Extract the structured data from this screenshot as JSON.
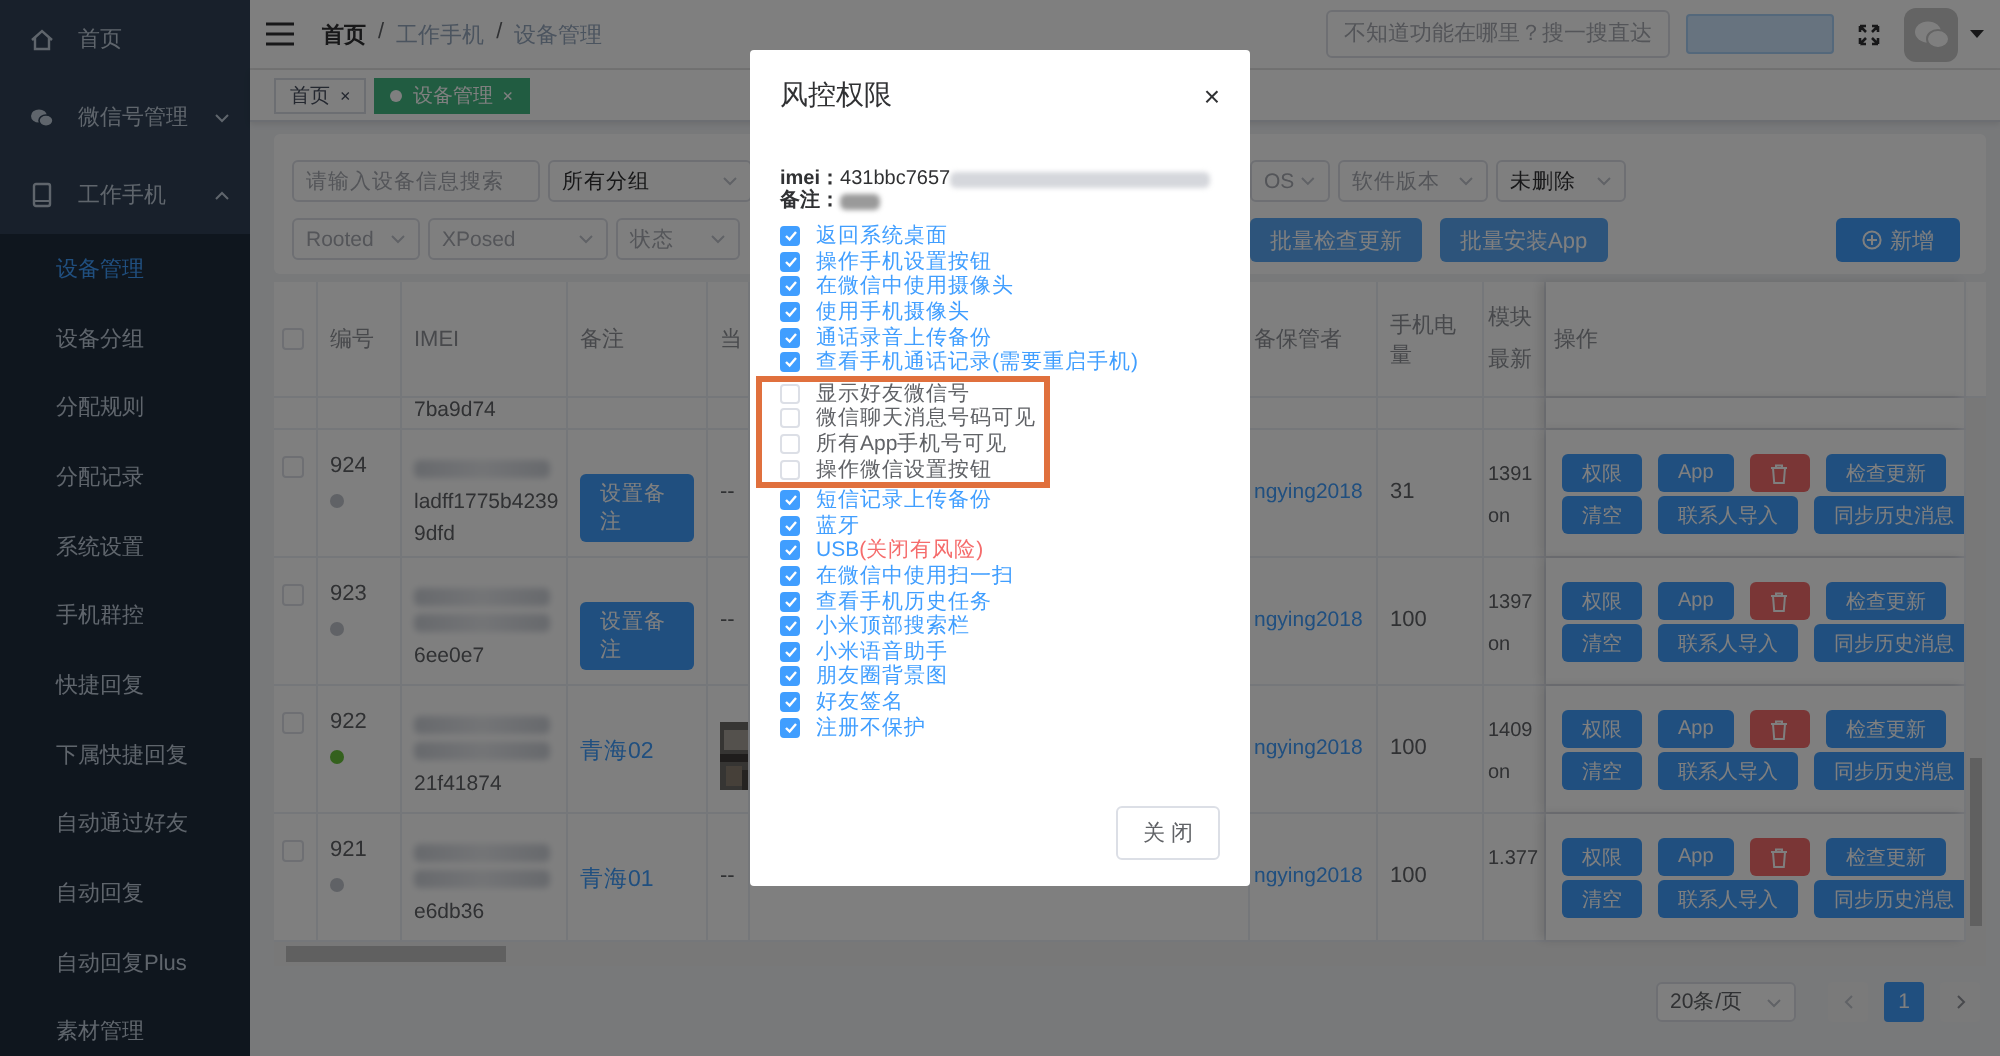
{
  "sidebar": {
    "items": [
      {
        "label": "首页"
      },
      {
        "label": "微信号管理",
        "expanded": false
      },
      {
        "label": "工作手机",
        "expanded": true,
        "children": [
          {
            "label": "设备管理",
            "selected": true
          },
          {
            "label": "设备分组",
            "selected": false
          },
          {
            "label": "分配规则",
            "selected": false
          },
          {
            "label": "分配记录",
            "selected": false
          },
          {
            "label": "系统设置",
            "selected": false
          },
          {
            "label": "手机群控",
            "selected": false
          },
          {
            "label": "快捷回复",
            "selected": false
          },
          {
            "label": "下属快捷回复",
            "selected": false
          },
          {
            "label": "自动通过好友",
            "selected": false
          },
          {
            "label": "自动回复",
            "selected": false
          },
          {
            "label": "自动回复Plus",
            "selected": false
          },
          {
            "label": "素材管理",
            "selected": false
          }
        ]
      }
    ]
  },
  "header": {
    "breadcrumb": [
      "首页",
      "工作手机",
      "设备管理"
    ],
    "separator": "/",
    "search": {
      "placeholder": "不知道功能在哪里？搜一搜直达"
    }
  },
  "tabs": [
    {
      "label": "首页",
      "close": "×",
      "selected": false
    },
    {
      "label": "设备管理",
      "close": "×",
      "selected": true
    }
  ],
  "filters": {
    "row_1_left": [
      {
        "kind": "input",
        "placeholder": "请输入设备信息搜索"
      },
      {
        "kind": "select",
        "value": "所有分组"
      }
    ],
    "row_1_right": [
      {
        "kind": "select",
        "placeholder": "OS"
      },
      {
        "kind": "select",
        "placeholder": "软件版本"
      },
      {
        "kind": "select",
        "value": "未删除"
      }
    ],
    "row_2_left": [
      {
        "kind": "select",
        "placeholder": "Rooted"
      },
      {
        "kind": "select",
        "placeholder": "XPosed"
      },
      {
        "kind": "select",
        "placeholder": "状态"
      }
    ],
    "row_2_right": [
      {
        "kind": "button",
        "label": "批量检查更新",
        "disabled": true
      },
      {
        "kind": "button",
        "label": "批量安装App",
        "disabled": true
      },
      {
        "kind": "add-button",
        "label": "新增",
        "disabled": false
      }
    ]
  },
  "table": {
    "columns": [
      "编号",
      "IMEI",
      "备注",
      "当",
      "备保管者",
      "手机电量",
      "模块最新",
      "操作"
    ],
    "select_all": false,
    "rows": [
      {
        "kind": "partial",
        "imei": [
          "7ba9d74"
        ]
      },
      {
        "kind": "full",
        "checked": false,
        "id": "924",
        "color": "#606266",
        "imei": [
          "ladff1775b4239",
          "9dfd"
        ],
        "remark": {
          "kind": "button",
          "text": "设置备注"
        },
        "current": {
          "kind": "text",
          "text": "--"
        },
        "keeper": "ngying2018",
        "battery": "31",
        "module": [
          "1391",
          "on"
        ],
        "actions": {
          "line_1": [
            {
              "kind": "primary",
              "label": "权限"
            },
            {
              "kind": "primary",
              "label": "App"
            },
            {
              "kind": "delete"
            },
            {
              "kind": "primary",
              "label": "检查更新"
            }
          ],
          "line_2": [
            {
              "kind": "primary",
              "label": "清空"
            },
            {
              "kind": "primary",
              "label": "联系人导入"
            },
            {
              "kind": "primary",
              "label": "同步历史消息"
            }
          ]
        }
      },
      {
        "kind": "full",
        "checked": false,
        "id": "923",
        "color": "#606266",
        "imei": [
          "6ee0e7"
        ],
        "remark": {
          "kind": "button",
          "text": "设置备注"
        },
        "current": {
          "kind": "text",
          "text": "--"
        },
        "keeper": "ngying2018",
        "battery": "100",
        "module": [
          "1397",
          "on"
        ],
        "actions": {
          "line_1": [
            {
              "kind": "primary",
              "label": "权限"
            },
            {
              "kind": "primary",
              "label": "App"
            },
            {
              "kind": "delete"
            },
            {
              "kind": "primary",
              "label": "检查更新"
            }
          ],
          "line_2": [
            {
              "kind": "primary",
              "label": "清空"
            },
            {
              "kind": "primary",
              "label": "联系人导入"
            },
            {
              "kind": "primary",
              "label": "同步历史消息"
            }
          ]
        }
      },
      {
        "kind": "full",
        "checked": false,
        "id": "922",
        "color": "#34611d",
        "imei": [
          "21f41874"
        ],
        "remark": {
          "kind": "link",
          "text": "青海02"
        },
        "current": {
          "kind": "picture"
        },
        "keeper": "ngying2018",
        "battery": "100",
        "module": [
          "1409",
          "on"
        ],
        "actions": {
          "line_1": [
            {
              "kind": "primary",
              "label": "权限"
            },
            {
              "kind": "primary",
              "label": "App"
            },
            {
              "kind": "delete"
            },
            {
              "kind": "primary",
              "label": "检查更新"
            }
          ],
          "line_2": [
            {
              "kind": "primary",
              "label": "清空"
            },
            {
              "kind": "primary",
              "label": "联系人导入"
            },
            {
              "kind": "primary",
              "label": "同步历史消息"
            }
          ]
        }
      },
      {
        "kind": "full",
        "checked": false,
        "id": "921",
        "color": "#606266",
        "imei": [
          "e6db36"
        ],
        "remark": {
          "kind": "link",
          "text": "青海01"
        },
        "current": {
          "kind": "text",
          "text": "--"
        },
        "keeper": "ngying2018",
        "battery": "100",
        "module": [
          "1.377"
        ],
        "actions": {
          "line_1": [
            {
              "kind": "primary",
              "label": "权限"
            },
            {
              "kind": "primary",
              "label": "App"
            },
            {
              "kind": "delete"
            },
            {
              "kind": "primary",
              "label": "检查更新"
            }
          ],
          "line_2": [
            {
              "kind": "primary",
              "label": "清空"
            },
            {
              "kind": "primary",
              "label": "联系人导入"
            },
            {
              "kind": "primary",
              "label": "同步历史消息"
            }
          ]
        }
      }
    ]
  },
  "pagination": {
    "page_size": "20条/页",
    "pages": [
      {
        "label": "1",
        "selected": true
      }
    ]
  },
  "dialog": {
    "title": "风控权限",
    "close": "×",
    "imei_label": "imei：",
    "imei_value": "431bbc7657",
    "remark_label": "备注：",
    "permissions": [
      {
        "label": "返回系统桌面",
        "checked": true,
        "highlighted": false
      },
      {
        "label": "操作手机设置按钮",
        "checked": true,
        "highlighted": false
      },
      {
        "label": "在微信中使用摄像头",
        "checked": true,
        "highlighted": false
      },
      {
        "label": "使用手机摄像头",
        "checked": true,
        "highlighted": false
      },
      {
        "label": "通话录音上传备份",
        "checked": true,
        "highlighted": false
      },
      {
        "label": "查看手机通话记录(需要重启手机)",
        "checked": true,
        "highlighted": false
      },
      {
        "label": "显示好友微信号",
        "checked": false,
        "highlighted": true
      },
      {
        "label": "微信聊天消息号码可见",
        "checked": false,
        "highlighted": true
      },
      {
        "label": "所有App手机号可见",
        "checked": false,
        "highlighted": true
      },
      {
        "label": "操作微信设置按钮",
        "checked": false,
        "highlighted": true
      },
      {
        "label": "短信记录上传备份",
        "checked": true,
        "highlighted": false
      },
      {
        "label": "蓝牙",
        "checked": true,
        "highlighted": false
      },
      {
        "label": "USB",
        "note": "(关闭有风险)",
        "checked": true,
        "highlighted": false
      },
      {
        "label": "在微信中使用扫一扫",
        "checked": true,
        "highlighted": false
      },
      {
        "label": "查看手机历史任务",
        "checked": true,
        "highlighted": false
      },
      {
        "label": "小米顶部搜索栏",
        "checked": true,
        "highlighted": false
      },
      {
        "label": "小米语音助手",
        "checked": true,
        "highlighted": false
      },
      {
        "label": "朋友圈背景图",
        "checked": true,
        "highlighted": false
      },
      {
        "label": "好友签名",
        "checked": true,
        "highlighted": false
      },
      {
        "label": "注册不保护",
        "checked": true,
        "highlighted": false
      }
    ],
    "close_button": "关 闭"
  }
}
